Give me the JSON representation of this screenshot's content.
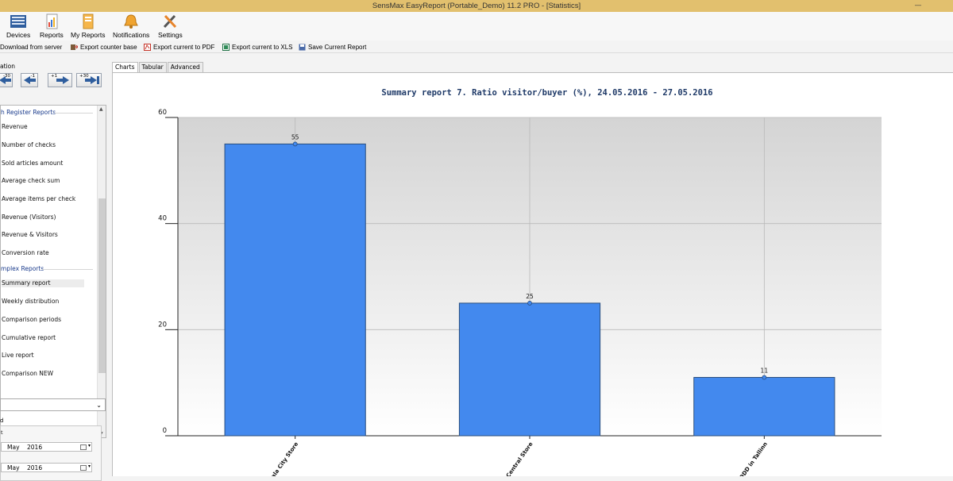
{
  "window": {
    "title": "SensMax EasyReport (Portable_Demo) 11.2 PRO - [Statistics]"
  },
  "ribbon": {
    "buttons": [
      {
        "label": "Devices",
        "icon": "devices-icon"
      },
      {
        "label": "Reports",
        "icon": "reports-icon"
      },
      {
        "label": "My Reports",
        "icon": "my-reports-icon"
      },
      {
        "label": "Notifications",
        "icon": "notifications-icon"
      },
      {
        "label": "Settings",
        "icon": "settings-icon"
      }
    ]
  },
  "toolbar": {
    "download": "Download from server",
    "export_counter": "Export counter base",
    "export_pdf": "Export current to PDF",
    "export_xls": "Export current to XLS",
    "save_report": "Save Current Report"
  },
  "navigation": {
    "label": "ation",
    "buttons": [
      "-30",
      "-1",
      "+1",
      "+30"
    ]
  },
  "reports": {
    "sections": [
      {
        "title": "h Register Reports",
        "items": [
          "Revenue",
          "Number of checks",
          "Sold articles amount",
          "Average check sum",
          "Average items per check",
          "Revenue (Visitors)",
          "Revenue & Visitors",
          "Conversion rate"
        ]
      },
      {
        "title": "mplex Reports",
        "items": [
          "Summary report",
          "Weekly distribution",
          "Comparison periods",
          "Cumulative report",
          "Live report",
          "Comparison NEW"
        ]
      }
    ],
    "selected": "Summary report"
  },
  "period": {
    "label": "d",
    "sublabel": "t",
    "from": {
      "month": "May",
      "year": "2016"
    },
    "to": {
      "month": "May",
      "year": "2016"
    }
  },
  "tabs": [
    "Charts",
    "Tabular",
    "Advanced"
  ],
  "active_tab": "Charts",
  "colors": {
    "bar": "#4389ee",
    "titlebar": "#e2c06e",
    "title_text": "#1f3a68"
  },
  "chart_data": {
    "type": "bar",
    "title": "Summary report 7. Ratio visitor/buyer (%), 24.05.2016 - 27.05.2016",
    "categories": [
      "Zala City Store",
      "Central Store",
      "p DDD in Tallinn"
    ],
    "values": [
      55,
      25,
      11
    ],
    "ylim": [
      0,
      60
    ],
    "yticks": [
      0,
      20,
      40,
      60
    ],
    "grid": true,
    "xlabel": "",
    "ylabel": ""
  }
}
